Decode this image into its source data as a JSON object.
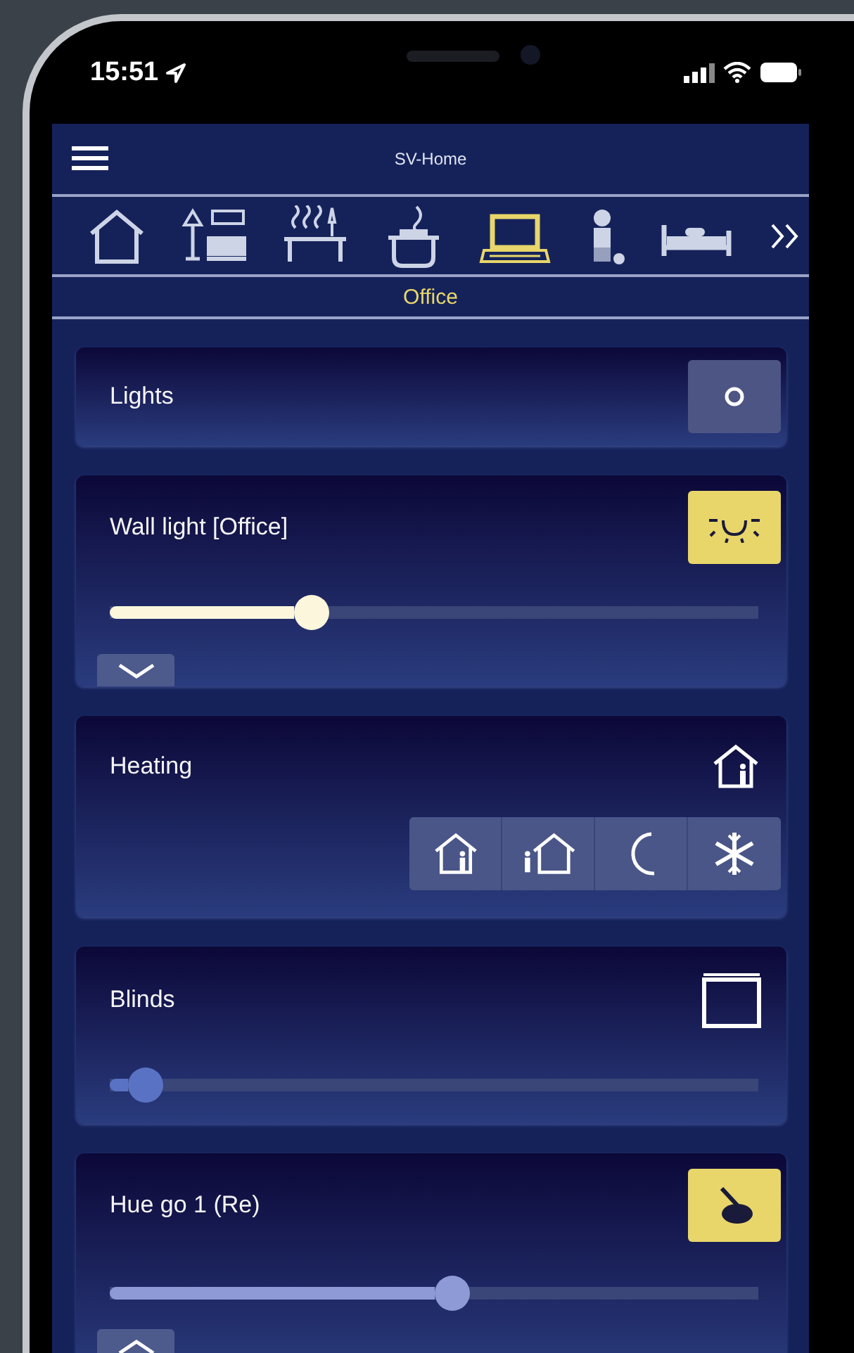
{
  "status_bar": {
    "time": "15:51"
  },
  "header": {
    "title": "SV-Home"
  },
  "rooms": [
    {
      "kind": "house",
      "selected": false
    },
    {
      "kind": "living",
      "selected": false
    },
    {
      "kind": "dining",
      "selected": false
    },
    {
      "kind": "kitchen",
      "selected": false
    },
    {
      "kind": "office",
      "selected": true
    },
    {
      "kind": "child",
      "selected": false
    },
    {
      "kind": "bedroom",
      "selected": false
    }
  ],
  "room_label": "Office",
  "cards": [
    {
      "kind": "switch",
      "title": "Lights",
      "on": false
    },
    {
      "kind": "dimmer",
      "title": "Wall light [Office]",
      "on": true,
      "level": 0.3,
      "expanded": false
    },
    {
      "kind": "heating",
      "title": "Heating",
      "modes": [
        {
          "kind": "comfort"
        },
        {
          "kind": "standby"
        },
        {
          "kind": "night"
        },
        {
          "kind": "frost"
        }
      ]
    },
    {
      "kind": "blinds",
      "title": "Blinds",
      "level": 0.03
    },
    {
      "kind": "color",
      "title": "Hue go 1 (Re)",
      "on": true,
      "level": 0.53,
      "expanded": true
    }
  ]
}
